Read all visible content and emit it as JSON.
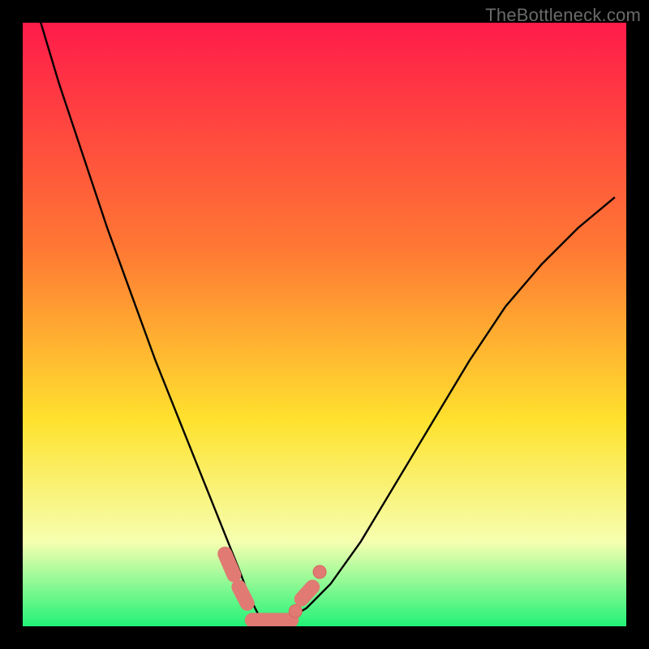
{
  "watermark": "TheBottleneck.com",
  "colors": {
    "frame": "#000000",
    "gradient_top": "#ff1b4a",
    "gradient_mid1": "#ff7a33",
    "gradient_mid2": "#ffe22e",
    "gradient_mid3": "#f6ffb0",
    "gradient_bottom": "#22f277",
    "curve": "#000000",
    "marker_fill": "#e07a72",
    "marker_stroke": "#d9645e"
  },
  "chart_data": {
    "type": "line",
    "title": "",
    "xlabel": "",
    "ylabel": "",
    "xlim": [
      0,
      100
    ],
    "ylim": [
      0,
      100
    ],
    "grid": false,
    "legend": false,
    "series": [
      {
        "name": "bottleneck-curve",
        "x": [
          3,
          6,
          10,
          14,
          18,
          22,
          26,
          30,
          32,
          34,
          36,
          37.5,
          39,
          40.5,
          42,
          44,
          47,
          51,
          56,
          62,
          68,
          74,
          80,
          86,
          92,
          98
        ],
        "y": [
          100,
          90,
          78,
          66,
          55,
          44,
          34,
          24,
          19,
          14,
          9,
          5,
          2,
          0.5,
          0.5,
          1.2,
          3,
          7,
          14,
          24,
          34,
          44,
          53,
          60,
          66,
          71
        ]
      }
    ],
    "markers": [
      {
        "kind": "pill",
        "x1": 33.5,
        "x2": 35.0,
        "y1": 12.0,
        "y2": 8.5
      },
      {
        "kind": "pill",
        "x1": 35.8,
        "x2": 37.2,
        "y1": 6.5,
        "y2": 3.8
      },
      {
        "kind": "pill",
        "x1": 38.0,
        "x2": 44.5,
        "y1": 1.0,
        "y2": 1.0
      },
      {
        "kind": "dot",
        "cx": 45.2,
        "cy": 2.5
      },
      {
        "kind": "pill",
        "x1": 46.2,
        "x2": 48.0,
        "y1": 4.5,
        "y2": 6.5
      },
      {
        "kind": "dot",
        "cx": 49.2,
        "cy": 9.0
      }
    ]
  }
}
